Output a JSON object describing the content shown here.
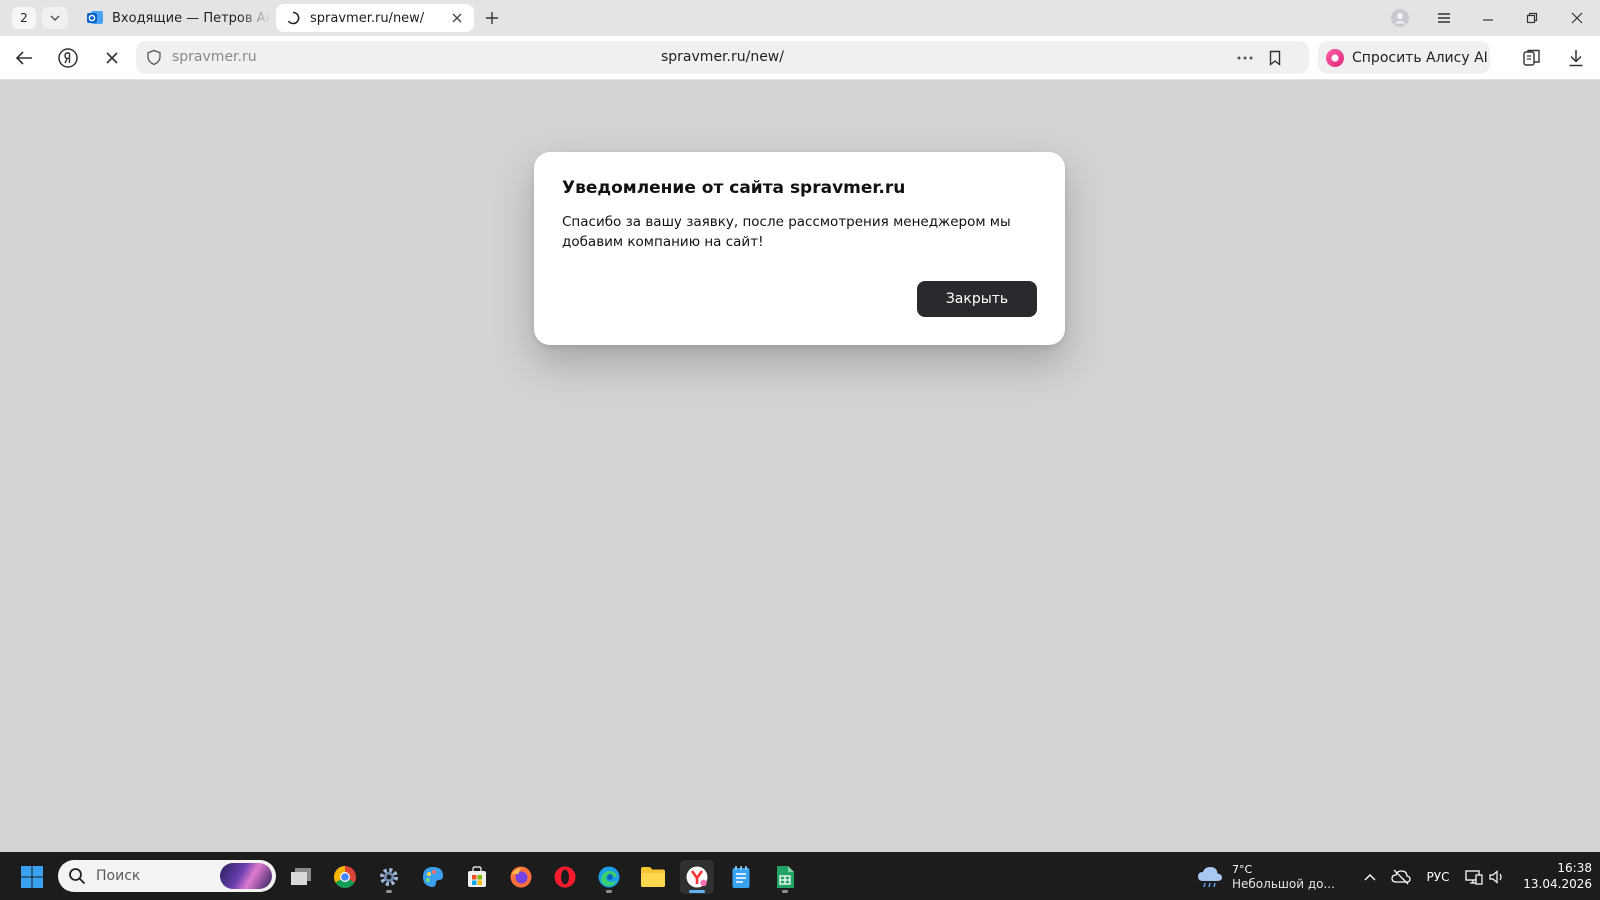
{
  "tabstrip": {
    "tab_count": "2",
    "tabs": [
      {
        "title": "Входящие — Петров Антон",
        "favicon": "outlook-icon",
        "active": false
      },
      {
        "title": "spravmer.ru/new/",
        "favicon": "loading-spinner-icon",
        "active": true
      }
    ],
    "window_buttons": [
      "profile-icon",
      "menu-icon",
      "minimize-icon",
      "restore-icon",
      "close-icon"
    ]
  },
  "toolbar": {
    "domain": "spravmer.ru",
    "url": "spravmer.ru/new/",
    "alice_label": "Спросить Алису AI"
  },
  "dialog": {
    "title": "Уведомление от сайта spravmer.ru",
    "message": "Спасибо за вашу заявку, после рассмотрения менеджером мы добавим компанию на сайт!",
    "close_label": "Закрыть"
  },
  "taskbar": {
    "search_placeholder": "Поиск",
    "apps": [
      "task-view",
      "chrome",
      "settings",
      "paint",
      "store",
      "firefox",
      "opera",
      "edge",
      "file-explorer",
      "yandex-browser",
      "notepad",
      "sheets"
    ],
    "weather": {
      "temp": "7°C",
      "desc": "Небольшой до..."
    },
    "language": "РУС",
    "time": "16:38",
    "date": "13.04.2026"
  },
  "colors": {
    "page_background": "#d3d3d3",
    "dialog_button": "#2a2a2e",
    "taskbar": "#1c1c1c",
    "alice_accent": "#ff4f9a"
  }
}
